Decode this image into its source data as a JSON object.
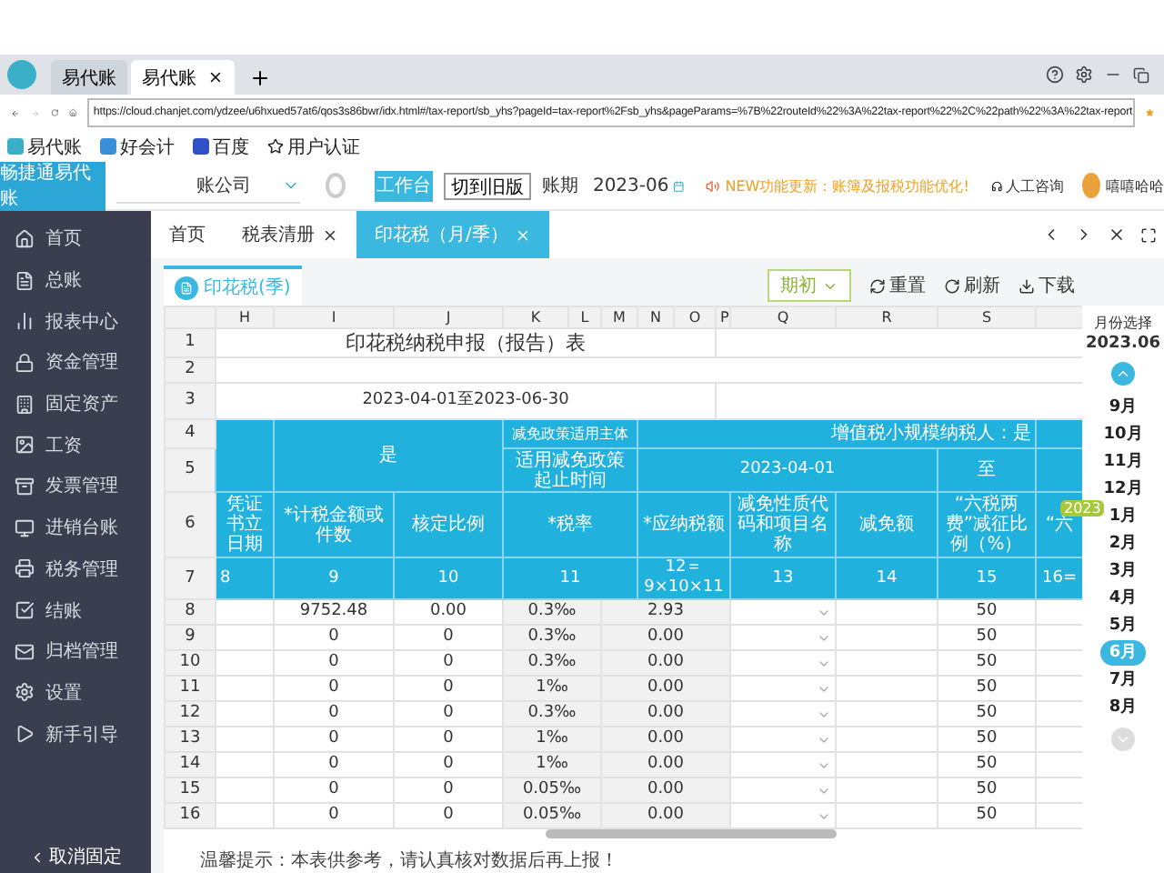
{
  "browser": {
    "tabs": [
      {
        "label": "易代账",
        "selected": false
      },
      {
        "label": "易代账",
        "selected": true
      }
    ],
    "url": "https://cloud.chanjet.com/ydzee/u6hxued57at6/qos3s86bwr/idx.html#/tax-report/sb_yhs?pageId=tax-report%2Fsb_yhs&pageParams=%7B%22routeId%22%3A%22tax-report%22%2C%22path%22%3A%22tax-report",
    "bookmarks": [
      "易代账",
      "好会计",
      "百度",
      "用户认证"
    ]
  },
  "header": {
    "brand": "畅捷通易代账",
    "company": "账公司",
    "workbench": "工作台",
    "switch": "切到旧版",
    "period_label": "账期",
    "period": "2023-06",
    "notice": "NEW功能更新：账簿及报税功能优化!",
    "support": "人工咨询",
    "user": "嘻嘻哈哈"
  },
  "sidebar": {
    "items": [
      "首页",
      "总账",
      "报表中心",
      "资金管理",
      "固定资产",
      "工资",
      "发票管理",
      "进销台账",
      "税务管理",
      "结账",
      "归档管理",
      "设置",
      "新手引导"
    ],
    "unpin": "取消固定"
  },
  "page_tabs": [
    {
      "label": "首页",
      "selected": false,
      "closable": false
    },
    {
      "label": "税表清册",
      "selected": false,
      "closable": true
    },
    {
      "label": "印花税（月/季）",
      "selected": true,
      "closable": true
    }
  ],
  "sheet_tab": "印花税(季)",
  "toolbar": {
    "period_select": "期初",
    "actions": [
      "重置",
      "刷新",
      "下载"
    ]
  },
  "sheet": {
    "column_letters": [
      "H",
      "I",
      "J",
      "K",
      "L",
      "M",
      "N",
      "O",
      "P",
      "Q",
      "R",
      "S"
    ],
    "top_row_numbers": [
      "1",
      "2",
      "3",
      "4",
      "5",
      "6",
      "7"
    ],
    "title": "印花税纳税申报（报告）表",
    "date_range": "2023-04-01至2023-06-30",
    "flag": "是",
    "subject_label": "减免政策适用主体",
    "taxpayer": "增值税小规模纳税人：是",
    "period_range_label": "适用减免政策起止时间",
    "start_date": "2023-04-01",
    "to": "至",
    "column_heads": [
      "凭证书立日期",
      "*计税金额或件数",
      "核定比例",
      "*税率",
      "*应纳税额",
      "减免性质代码和项目名称",
      "减免额",
      "“六税两费”减征比例（%）",
      "“六"
    ],
    "column_numbers": [
      "8",
      "9",
      "10",
      "11",
      "12＝9×10×11",
      "13",
      "14",
      "15",
      "16="
    ],
    "rows": [
      {
        "num": "8",
        "amount": "9752.48",
        "ratio": "0.00",
        "rate": "0.3‰",
        "tax": "2.93",
        "reduction_pct": "50"
      },
      {
        "num": "9",
        "amount": "0",
        "ratio": "0",
        "rate": "0.3‰",
        "tax": "0.00",
        "reduction_pct": "50"
      },
      {
        "num": "10",
        "amount": "0",
        "ratio": "0",
        "rate": "0.3‰",
        "tax": "0.00",
        "reduction_pct": "50"
      },
      {
        "num": "11",
        "amount": "0",
        "ratio": "0",
        "rate": "1‰",
        "tax": "0.00",
        "reduction_pct": "50"
      },
      {
        "num": "12",
        "amount": "0",
        "ratio": "0",
        "rate": "0.3‰",
        "tax": "0.00",
        "reduction_pct": "50"
      },
      {
        "num": "13",
        "amount": "0",
        "ratio": "0",
        "rate": "1‰",
        "tax": "0.00",
        "reduction_pct": "50"
      },
      {
        "num": "14",
        "amount": "0",
        "ratio": "0",
        "rate": "1‰",
        "tax": "0.00",
        "reduction_pct": "50"
      },
      {
        "num": "15",
        "amount": "0",
        "ratio": "0",
        "rate": "0.05‰",
        "tax": "0.00",
        "reduction_pct": "50"
      },
      {
        "num": "16",
        "amount": "0",
        "ratio": "0",
        "rate": "0.05‰",
        "tax": "0.00",
        "reduction_pct": "50"
      }
    ]
  },
  "tip": "温馨提示：本表供参考，请认真核对数据后再上报！",
  "month_picker": {
    "title": "月份选择",
    "current": "2023.06",
    "year_badge": "2023",
    "months": [
      {
        "label": "9月",
        "selected": false
      },
      {
        "label": "10月",
        "selected": false
      },
      {
        "label": "11月",
        "selected": false
      },
      {
        "label": "12月",
        "selected": false
      },
      {
        "label": "1月",
        "selected": false
      },
      {
        "label": "2月",
        "selected": false
      },
      {
        "label": "3月",
        "selected": false
      },
      {
        "label": "4月",
        "selected": false
      },
      {
        "label": "5月",
        "selected": false
      },
      {
        "label": "6月",
        "selected": true
      },
      {
        "label": "7月",
        "selected": false
      },
      {
        "label": "8月",
        "selected": false
      }
    ]
  }
}
